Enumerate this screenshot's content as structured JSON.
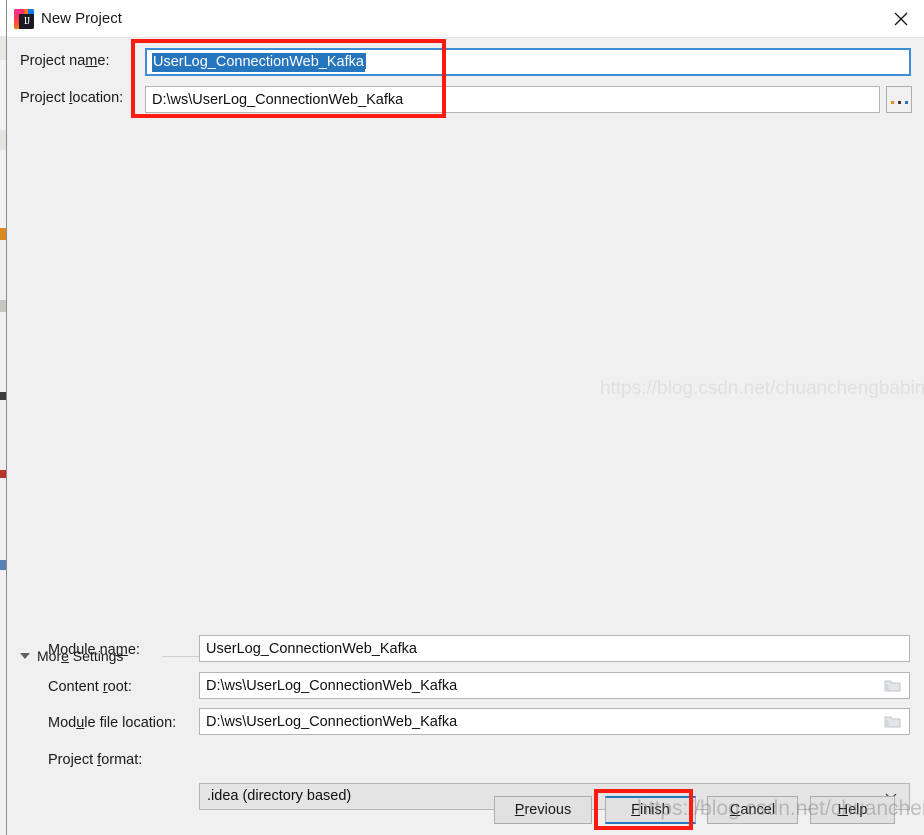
{
  "window": {
    "title": "New Project",
    "app_icon": "intellij-idea-icon",
    "icon_glyph": "IJ",
    "close_icon": "close-icon"
  },
  "form": {
    "project_name": {
      "label_before": "Project na",
      "label_mnemonic": "m",
      "label_after": "e:",
      "value": "UserLog_ConnectionWeb_Kafka",
      "selected": true
    },
    "project_location": {
      "label_before": "Project ",
      "label_mnemonic": "l",
      "label_after": "ocation:",
      "value": "D:\\ws\\UserLog_ConnectionWeb_Kafka",
      "browse_label": "...",
      "browse_icon": "ellipsis-browse-icon"
    }
  },
  "more_settings": {
    "label_before": "Mor",
    "label_mnemonic": "e",
    "label_after": " Settings",
    "expanded": true,
    "collapse_icon": "triangle-down-icon",
    "fields": [
      {
        "name": "module-name",
        "label_before": "Module na",
        "label_mnemonic": "m",
        "label_after": "e:",
        "value": "UserLog_ConnectionWeb_Kafka",
        "has_folder_icon": false
      },
      {
        "name": "content-root",
        "label_before": "Content ",
        "label_mnemonic": "r",
        "label_after": "oot:",
        "value": "D:\\ws\\UserLog_ConnectionWeb_Kafka",
        "has_folder_icon": true
      },
      {
        "name": "module-file-location",
        "label_before": "Mod",
        "label_mnemonic": "u",
        "label_after": "le file location:",
        "value": "D:\\ws\\UserLog_ConnectionWeb_Kafka",
        "has_folder_icon": true
      }
    ],
    "project_format": {
      "label_before": "Project ",
      "label_mnemonic": "f",
      "label_after": "ormat:",
      "value": ".idea (directory based)",
      "arrow_icon": "chevron-down-icon"
    }
  },
  "buttons": {
    "previous": {
      "before": "",
      "mnemonic": "P",
      "after": "revious",
      "focused": false
    },
    "finish": {
      "before": "",
      "mnemonic": "F",
      "after": "inish",
      "focused": true
    },
    "cancel": {
      "before": "",
      "mnemonic": "C",
      "after": "ancel",
      "focused": false
    },
    "help": {
      "before": "",
      "mnemonic": "H",
      "after": "elp",
      "focused": false
    }
  },
  "annotations": {
    "accent_color": "#fc1b10",
    "boxes": [
      "project-fields-highlight",
      "finish-button-highlight"
    ]
  },
  "watermarks": {
    "primary": "https://blog.csdn.net/chuanchengbabing",
    "secondary": "https://blog.csdn.net/chuanchengbabing"
  }
}
